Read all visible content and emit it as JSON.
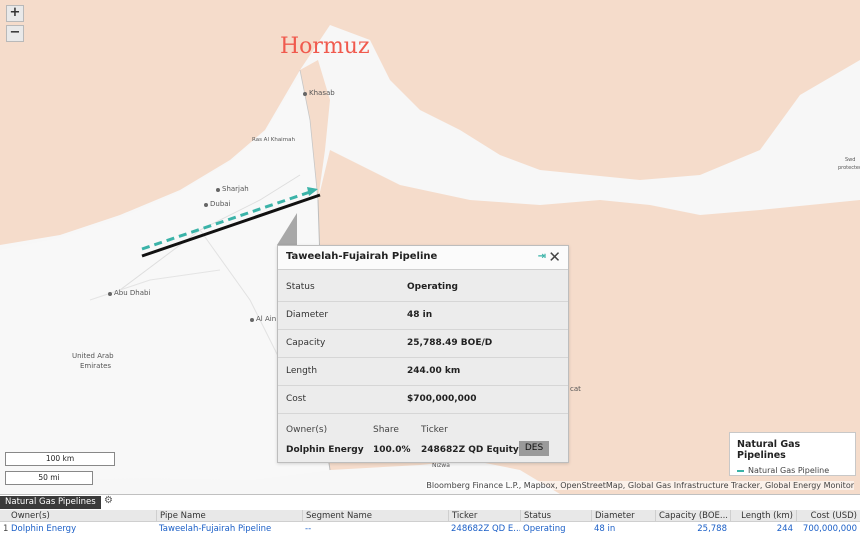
{
  "map": {
    "annotation": "Hormuz",
    "zoom_in": "+",
    "zoom_out": "−",
    "labels": {
      "khasab": "Khasab",
      "ras_al_khaimah": "Ras Al Khaimah",
      "sharjah": "Sharjah",
      "dubai": "Dubai",
      "abu_dhabi": "Abu Dhabi",
      "al_ain": "Al Ain",
      "uae_line1": "United Arab",
      "uae_line2": "Emirates",
      "nizwa": "Nizwa",
      "muscat_partial": "cat",
      "right_edge_1": "Swd",
      "right_edge_2": "protected"
    },
    "scale": {
      "km": "100 km",
      "mi": "50 mi"
    },
    "attribution": "Bloomberg Finance L.P., Mapbox, OpenStreetMap, Global Gas Infrastructure Tracker, Global Energy Monitor",
    "colors": {
      "land_tint": "#f5dccb",
      "pipeline_black": "#111111",
      "pipeline_teal": "#3bb3a8"
    }
  },
  "popup": {
    "title": "Taweelah-Fujairah Pipeline",
    "pin_icon": "pin-icon",
    "close": "✕",
    "rows": [
      {
        "key": "Status",
        "value": "Operating"
      },
      {
        "key": "Diameter",
        "value": "48 in"
      },
      {
        "key": "Capacity",
        "value": "25,788.49 BOE/D"
      },
      {
        "key": "Length",
        "value": "244.00 km"
      },
      {
        "key": "Cost",
        "value": "$700,000,000"
      }
    ],
    "owners_header": {
      "owner": "Owner(s)",
      "share": "Share",
      "ticker": "Ticker"
    },
    "owners": [
      {
        "owner": "Dolphin Energy",
        "share": "100.0%",
        "ticker": "248682Z QD Equity",
        "button": "DES"
      }
    ]
  },
  "legend": {
    "title": "Natural Gas Pipelines",
    "item": "Natural Gas Pipeline"
  },
  "panel": {
    "tab": "Natural Gas Pipelines",
    "columns": [
      "Owner(s)",
      "Pipe Name",
      "Segment Name",
      "Ticker",
      "Status",
      "Diameter",
      "Capacity (BOE...",
      "Length (km)",
      "Cost (USD)"
    ],
    "rows": [
      {
        "index": "1",
        "owner": "Dolphin Energy",
        "pipe": "Taweelah-Fujairah Pipeline",
        "segment": "--",
        "ticker": "248682Z QD E...",
        "status": "Operating",
        "diameter": "48 in",
        "capacity": "25,788",
        "length": "244",
        "cost": "700,000,000"
      }
    ]
  }
}
